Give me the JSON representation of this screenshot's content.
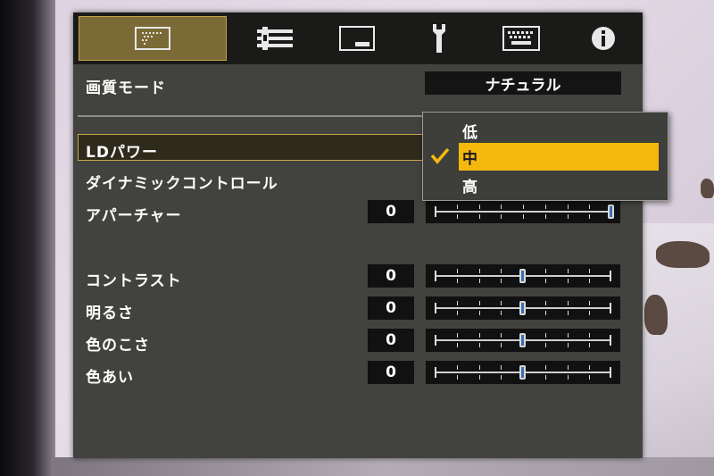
{
  "tabs": [
    {
      "name": "picture-tab",
      "icon": "picture-adjust-icon"
    },
    {
      "name": "input-settings-tab",
      "icon": "sliders-icon"
    },
    {
      "name": "display-tab",
      "icon": "screen-icon"
    },
    {
      "name": "installation-tab",
      "icon": "wrench-icon"
    },
    {
      "name": "function-tab",
      "icon": "keyboard-icon"
    },
    {
      "name": "information-tab",
      "icon": "info-icon"
    }
  ],
  "picture_mode": {
    "label": "画質モード",
    "value": "ナチュラル"
  },
  "menu": {
    "ld_power": "LDパワー",
    "dynamic_control": "ダイナミックコントロール",
    "aperture": {
      "label": "アパーチャー",
      "value": "0",
      "level": 1.0
    },
    "contrast": {
      "label": "コントラスト",
      "value": "0",
      "level": 0.5
    },
    "brightness": {
      "label": "明るさ",
      "value": "0",
      "level": 0.5
    },
    "color": {
      "label": "色のこさ",
      "value": "0",
      "level": 0.5
    },
    "tint": {
      "label": "色あい",
      "value": "0",
      "level": 0.5
    }
  },
  "dropdown": {
    "options": [
      "低",
      "中",
      "高"
    ],
    "selected_index": 1,
    "check_icon": "checkmark-icon"
  },
  "colors": {
    "accent": "#f5b90d",
    "panel": "#42433f",
    "tabbar": "#1a1b19"
  }
}
